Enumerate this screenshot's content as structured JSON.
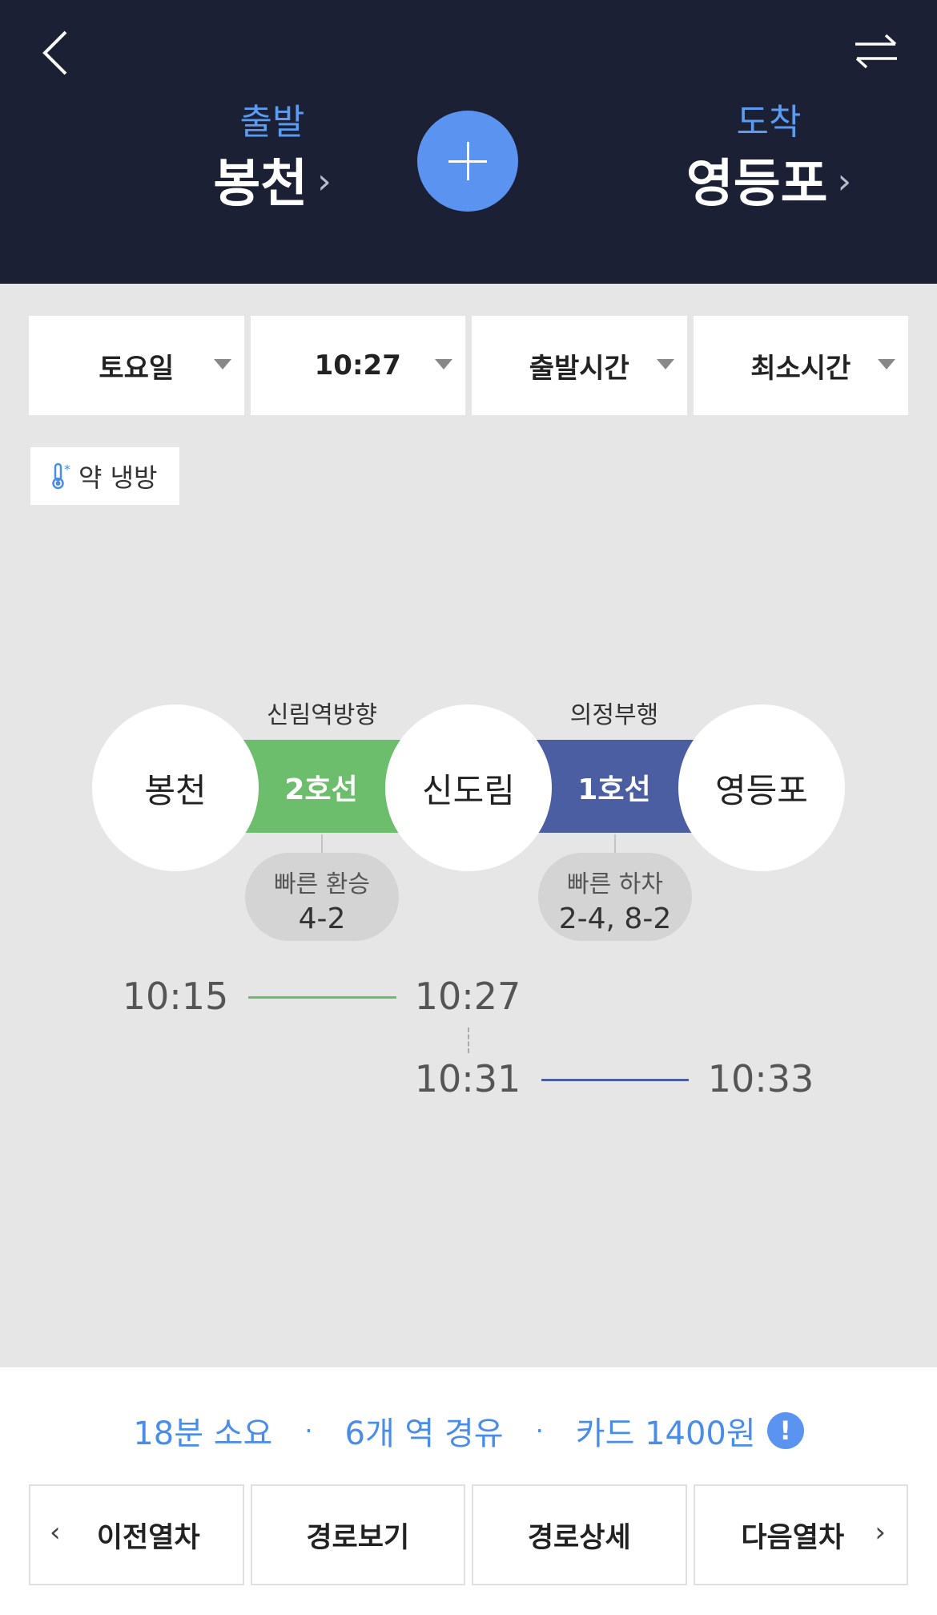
{
  "header": {
    "departure": {
      "label": "출발",
      "station": "봉천"
    },
    "arrival": {
      "label": "도착",
      "station": "영등포"
    }
  },
  "filters": [
    {
      "value": "토요일"
    },
    {
      "value": "10:27"
    },
    {
      "value": "출발시간"
    },
    {
      "value": "최소시간"
    }
  ],
  "cooling": {
    "label": "약 냉방"
  },
  "route": {
    "stations": [
      "봉천",
      "신도림",
      "영등포"
    ],
    "segments": [
      {
        "line": "2호선",
        "direction": "신림역방향",
        "tip_title": "빠른 환승",
        "tip_value": "4-2",
        "color": "#6cbd6c"
      },
      {
        "line": "1호선",
        "direction": "의정부행",
        "tip_title": "빠른 하차",
        "tip_value": "2-4, 8-2",
        "color": "#4b5ea2"
      }
    ],
    "times": {
      "leg1_depart": "10:15",
      "leg1_arrive": "10:27",
      "leg2_depart": "10:31",
      "leg2_arrive": "10:33"
    }
  },
  "summary": {
    "duration": "18분 소요",
    "stations": "6개 역 경유",
    "fare": "카드 1400원",
    "separator": "·",
    "info": "!"
  },
  "nav": {
    "prev": "이전열차",
    "route_view": "경로보기",
    "route_detail": "경로상세",
    "next": "다음열차"
  }
}
